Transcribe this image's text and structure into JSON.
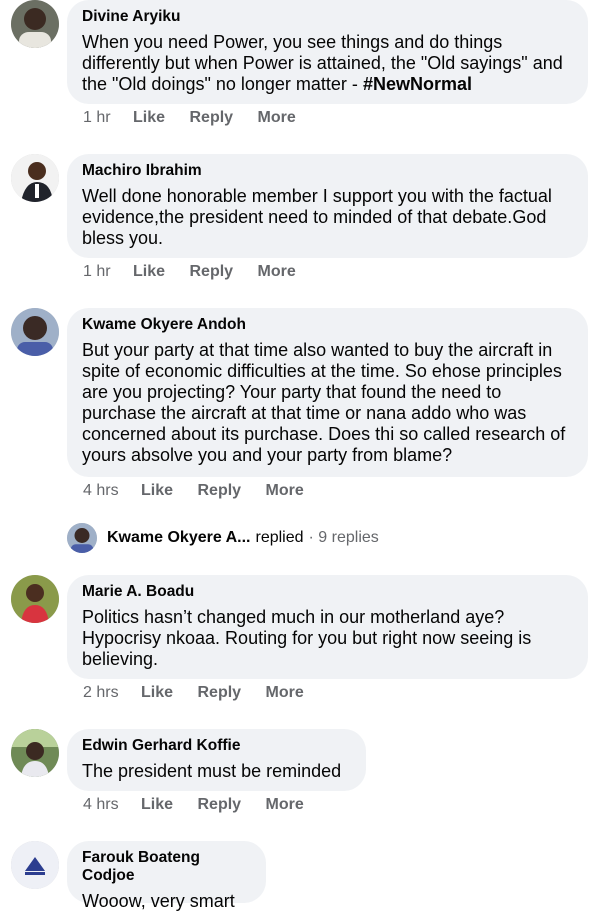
{
  "comments": [
    {
      "author": "Divine Aryiku",
      "text": "When you need Power, you see things and do things differently but when Power is attained, the \"Old sayings\" and the \"Old doings\" no longer matter - ",
      "hashtag": "#NewNormal",
      "time": "1 hr",
      "like": "Like",
      "reply": "Reply",
      "more": "More"
    },
    {
      "author": "Machiro Ibrahim",
      "text": "Well done honorable member I support you with the factual evidence,the president need to minded of that debate.God bless you.",
      "time": "1 hr",
      "like": "Like",
      "reply": "Reply",
      "more": "More"
    },
    {
      "author": "Kwame Okyere Andoh",
      "text": "But your party at that time also wanted to buy the aircraft in spite of economic difficulties at the time. So ehose principles are you projecting? Your party that found the need to purchase the aircraft at that time or nana addo who was concerned about its purchase. Does thi so called research of yours absolve you and your party from blame?",
      "time": "4 hrs",
      "like": "Like",
      "reply": "Reply",
      "more": "More"
    },
    {
      "author": "Marie A. Boadu",
      "text": "Politics hasn’t changed much in our motherland aye? Hypocrisy nkoaa. Routing for you but right now seeing is believing.",
      "time": "2 hrs",
      "like": "Like",
      "reply": "Reply",
      "more": "More"
    },
    {
      "author": "Edwin Gerhard Koffie",
      "text": "The president must be reminded",
      "time": "4 hrs",
      "like": "Like",
      "reply": "Reply",
      "more": "More"
    },
    {
      "author": "Farouk Boateng Codjoe",
      "text": "Wooow, very smart"
    }
  ],
  "replies": {
    "name": "Kwame Okyere A...",
    "verb": "replied",
    "count": "· 9 replies"
  }
}
